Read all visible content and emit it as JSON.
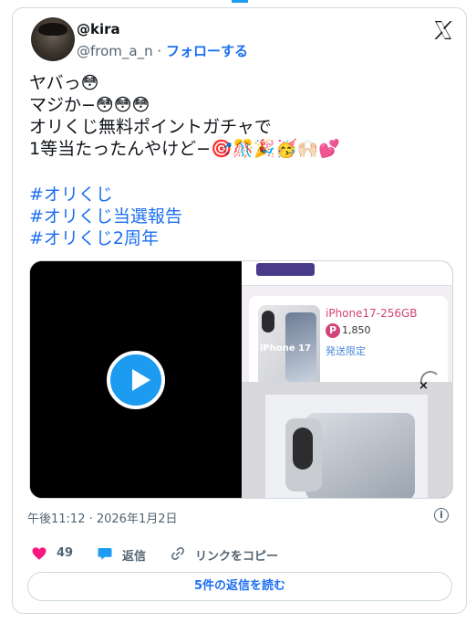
{
  "author": {
    "display_name": "@kira",
    "handle": "@from_a_n",
    "separator": "·",
    "follow_label": "フォローする"
  },
  "platform_icon": "x-logo-icon",
  "tweet": {
    "text": "ヤバっ😳\nマジか−😳😳😳\nオリくじ無料ポイントガチャで\n1等当たったんやけど−🎯🎊🎉🥳🙌🏻💕",
    "hashtags": [
      "#オリくじ",
      "#オリくじ当選報告",
      "#オリくじ2周年"
    ]
  },
  "media": {
    "video": {
      "play_icon": "play-icon"
    },
    "screenshot": {
      "product_title": "iPhone17-256GB",
      "product_image_label": "iPhone 17",
      "points_badge": "P",
      "points": "1,850",
      "shipping_note": "発送限定",
      "popup_close": "×"
    }
  },
  "timestamp": "午後11:12 · 2026年1月2日",
  "actions": {
    "likes": "49",
    "reply_label": "返信",
    "copy_link_label": "リンクをコピー"
  },
  "read_replies_label": "5件の返信を読む",
  "colors": {
    "accent": "#1d6ff0",
    "like": "#f91880",
    "reply": "#1d9bf0",
    "muted": "#536471"
  }
}
